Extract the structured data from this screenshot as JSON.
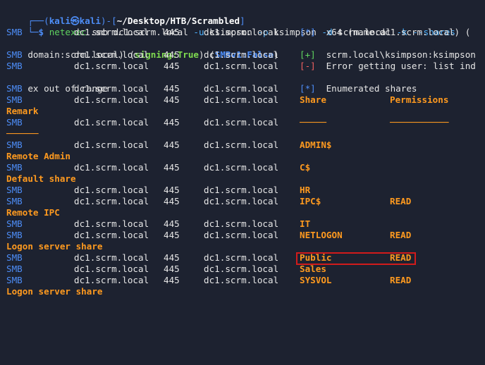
{
  "prompt": {
    "corner_top": "┌──(",
    "user": "kali㉿kali",
    "close_paren": ")-[",
    "path": "~/Desktop/HTB/Scrambled",
    "close_bracket": "]",
    "corner_bottom": "└─",
    "dollar": "$ ",
    "cmd": "netexec",
    "args": " smb dc1.scrm.local ",
    "flag_u": "-u",
    "val_u": " ksimpson ",
    "flag_p": "-p",
    "val_p": " ksimpson ",
    "flag_d": "-d",
    "val_d": " scrm.local ",
    "flag_k": "-k",
    "flag_shares": " --shares"
  },
  "columns": {
    "proto": "SMB",
    "host": "dc1.scrm.local",
    "port": "445",
    "name": "dc1.scrm.local"
  },
  "info_line1": {
    "marker": "[*]",
    "text": " x64 (name:dc1.scrm.local) (",
    "wrap": "domain:scrm.local) (",
    "signing": "signing:True",
    "mid": ") (",
    "smbv1": "SMBv1:False",
    "end": ")"
  },
  "auth_line": {
    "marker": "[+]",
    "text": " scrm.local\\ksimpson:ksimpson"
  },
  "error_line": {
    "marker": "[-]",
    "text": " Error getting user: list ind",
    "wrap": "ex out of range"
  },
  "enum_line": {
    "marker": "[*]",
    "text": " Enumerated shares"
  },
  "share_header": {
    "share": "Share",
    "permissions": "Permissions",
    "remark": "Remark",
    "share_rule": "─────",
    "perm_rule": "───────────",
    "remark_rule": "──────"
  },
  "shares": [
    {
      "name": "ADMIN$",
      "perm": "",
      "remark": "Remote Admin"
    },
    {
      "name": "C$",
      "perm": "",
      "remark": "Default share"
    },
    {
      "name": "HR",
      "perm": "",
      "remark": ""
    },
    {
      "name": "IPC$",
      "perm": "READ",
      "remark": "Remote IPC"
    },
    {
      "name": "IT",
      "perm": "",
      "remark": ""
    },
    {
      "name": "NETLOGON",
      "perm": "READ",
      "remark": "Logon server share"
    },
    {
      "name": "Public",
      "perm": "READ",
      "remark": ""
    },
    {
      "name": "Sales",
      "perm": "",
      "remark": ""
    },
    {
      "name": "SYSVOL",
      "perm": "READ",
      "remark": "Logon server share"
    }
  ],
  "colors": {
    "background": "#1d2230",
    "prompt_blue": "#4d8df7",
    "share_orange": "#ff9a1f",
    "highlight_red": "#d21b1b"
  }
}
